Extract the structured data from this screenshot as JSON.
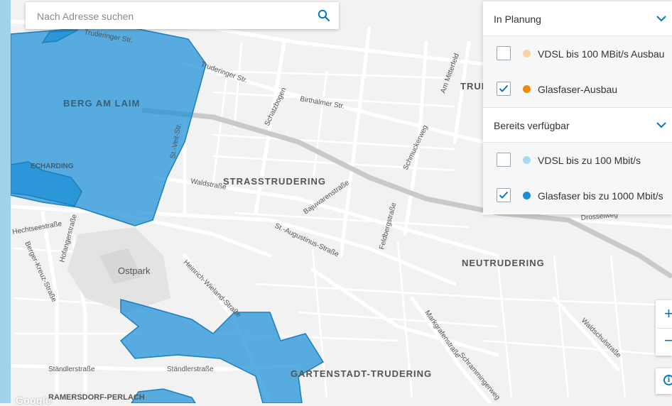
{
  "search": {
    "placeholder": "Nach Adresse suchen"
  },
  "legend": {
    "planning": {
      "title": "In Planung",
      "items": [
        {
          "label": "VDSL bis 100 MBit/s Ausbau",
          "checked": false,
          "color": "#f8d3a4"
        },
        {
          "label": "Glasfaser-Ausbau",
          "checked": true,
          "color": "#f0890e"
        }
      ]
    },
    "available": {
      "title": "Bereits verfügbar",
      "items": [
        {
          "label": "VDSL bis zu 100 Mbit/s",
          "checked": false,
          "color": "#a9daf2"
        },
        {
          "label": "Glasfaser bis zu 1000 Mbit/s",
          "checked": true,
          "color": "#1a8fd6"
        }
      ]
    }
  },
  "zoom": {
    "in": "+",
    "out": "−"
  },
  "info": {
    "symbol": "i"
  },
  "map": {
    "attribution": "Google",
    "coverage_color": "#1a8fd6",
    "districts": [
      "BERG AM LAIM",
      "STRASSTRUDERING",
      "NEUTRUDERING",
      "GARTENSTADT-TRUDERING",
      "RAMERSDORF-PERLACH",
      "ECHARDING",
      "TRUD"
    ],
    "parks": [
      "Ostpark"
    ],
    "streets": [
      "Truderinger Str.",
      "Truderinger Str.",
      "Birthälmer Str.",
      "Schatzbogen",
      "Am Mitterfeld",
      "Schmuckerweg",
      "St.-Veit-Str.",
      "Waldstraße",
      "Bajuwarenstraße",
      "St.-Augustinus-Straße",
      "Feldbergstraße",
      "Hechtseestraße",
      "Hofangerstraße",
      "Berger-Kreuz-Straße",
      "Heinrich-Wieland-Straße",
      "Ständlerstraße",
      "Ständlerstraße",
      "Markgrafenstraße",
      "Schrammingerweg",
      "Waldschulstraße",
      "Drosselweg"
    ]
  }
}
